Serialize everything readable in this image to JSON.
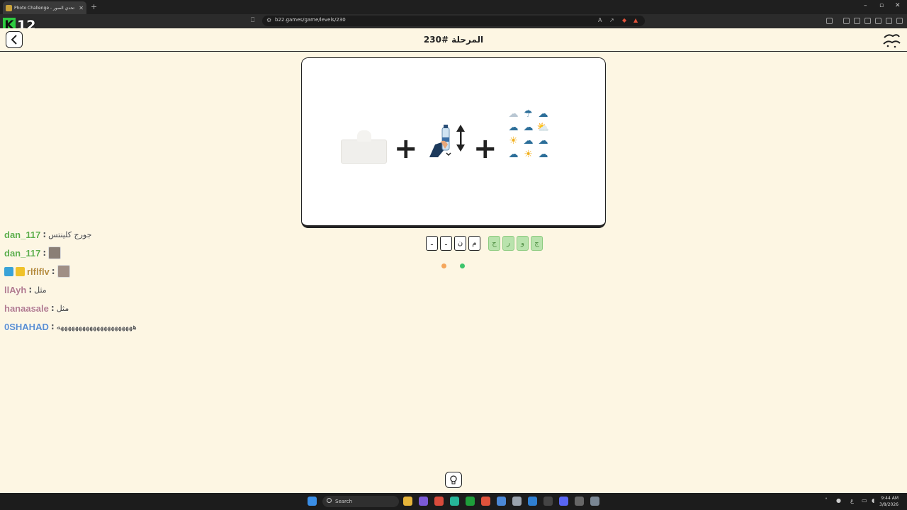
{
  "browser": {
    "tab_title": "Photo Challenge - تحدي الصور",
    "tab_close": "✕",
    "new_tab": "+",
    "url": "b22.games/game/levels/230",
    "window_controls": [
      "–",
      "▫",
      "✕"
    ]
  },
  "overlay": {
    "k12_number": "12"
  },
  "app": {
    "back_icon": "chevron-left-icon",
    "level_title": "المرحلة #230",
    "logo_text": "تحدي الصور"
  },
  "puzzle": {
    "images": [
      "tissue-box",
      "hand-bottle-arrows",
      "weather-icons-grid"
    ],
    "operators": [
      "+",
      "+"
    ]
  },
  "answer": {
    "slots": [
      "ـ",
      "ـ",
      "ن",
      "م"
    ],
    "letter_tiles": [
      "ج",
      "ر",
      "و",
      "ج"
    ]
  },
  "colors": {
    "page_bg": "#fdf6e3",
    "tile_green": "#b9e3ad",
    "dot_orange": "#f5a65b",
    "dot_green": "#3cc46b"
  },
  "chat": [
    {
      "user": "dan_117",
      "user_color": "#5fae4a",
      "text": "جورج كلينتس"
    },
    {
      "user": "dan_117",
      "user_color": "#5fae4a",
      "text": ""
    },
    {
      "user": "rlflflv",
      "user_color": "#b58b3c",
      "text": ""
    },
    {
      "user": "llAyh",
      "user_color": "#b27b8d",
      "text": "مثل"
    },
    {
      "user": "hanaasale",
      "user_color": "#b27b8d",
      "text": "مثل"
    },
    {
      "user": "0SHAHAD",
      "user_color": "#5b8fd1",
      "text": "هههههههههههههههههههههه"
    }
  ],
  "taskbar": {
    "search_label": "Search",
    "time": "9:44 AM",
    "date": "3/8/2026"
  }
}
